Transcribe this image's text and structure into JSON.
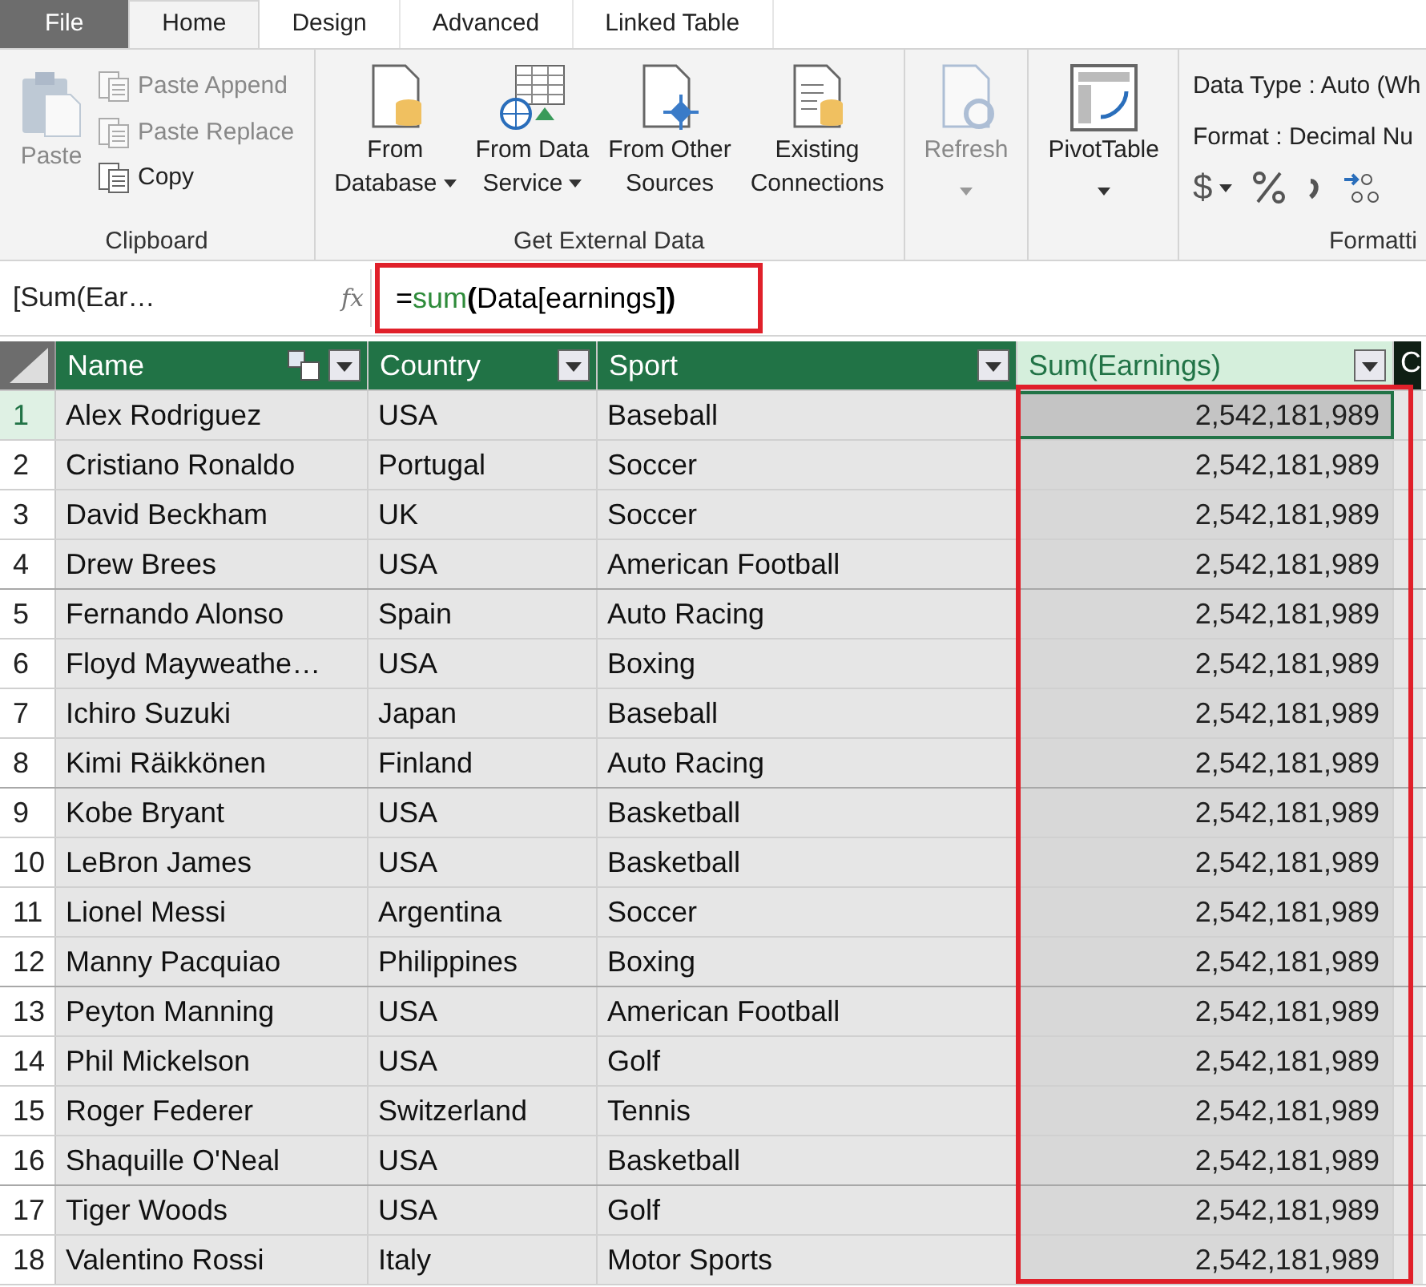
{
  "tabs": [
    {
      "label": "File",
      "kind": "file",
      "selected": false
    },
    {
      "label": "Home",
      "kind": "tab",
      "selected": true
    },
    {
      "label": "Design",
      "kind": "tab",
      "selected": false
    },
    {
      "label": "Advanced",
      "kind": "tab",
      "selected": false
    },
    {
      "label": "Linked Table",
      "kind": "tab",
      "selected": false
    }
  ],
  "ribbon": {
    "groups": [
      {
        "label": "Clipboard",
        "kind": "clipboard",
        "large": {
          "label": "Paste",
          "disabled": true
        },
        "small": [
          {
            "label": "Paste Append",
            "disabled": true
          },
          {
            "label": "Paste Replace",
            "disabled": true
          },
          {
            "label": "Copy",
            "disabled": false
          }
        ]
      },
      {
        "label": "Get External Data",
        "kind": "external",
        "buttons": [
          {
            "lines": [
              "From",
              "Database"
            ],
            "dropdown": true,
            "disabled": false
          },
          {
            "lines": [
              "From Data",
              "Service"
            ],
            "dropdown": true,
            "disabled": false
          },
          {
            "lines": [
              "From Other",
              "Sources"
            ],
            "dropdown": false,
            "disabled": false
          },
          {
            "lines": [
              "Existing",
              "Connections"
            ],
            "dropdown": false,
            "disabled": false
          }
        ]
      },
      {
        "kind": "refresh",
        "buttons": [
          {
            "lines": [
              "Refresh"
            ],
            "dropdown": true,
            "disabled": true
          }
        ]
      },
      {
        "kind": "pivot",
        "buttons": [
          {
            "lines": [
              "PivotTable"
            ],
            "dropdown": true,
            "disabled": false
          }
        ]
      },
      {
        "label": "Formatti",
        "kind": "formatting",
        "fields": [
          "Data Type : Auto (Wh",
          "Format : Decimal Nu"
        ],
        "currency_symbol": "$"
      }
    ]
  },
  "formula_bar": {
    "name_box": "[Sum(Ear…",
    "fx_label": "fx",
    "highlighted": true,
    "formula": [
      {
        "text": "=",
        "kind": "plain"
      },
      {
        "text": "sum",
        "kind": "function"
      },
      {
        "text": "(",
        "kind": "paren"
      },
      {
        "text": "Data[earnings",
        "kind": "plain"
      },
      {
        "text": "])",
        "kind": "paren"
      }
    ]
  },
  "table": {
    "columns": [
      {
        "label": "Name",
        "kind": "column",
        "sort_icon": true
      },
      {
        "label": "Country",
        "kind": "column",
        "sort_icon": false
      },
      {
        "label": "Sport",
        "kind": "column",
        "sort_icon": false
      },
      {
        "label": "Sum(Earnings)",
        "kind": "measure",
        "sort_icon": false
      },
      {
        "label": "C",
        "kind": "cut"
      }
    ],
    "measure_highlighted": true,
    "rows": [
      {
        "number": "1",
        "selected": true,
        "cells": [
          "Alex Rodriguez",
          "USA",
          "Baseball",
          "2,542,181,989"
        ]
      },
      {
        "number": "2",
        "selected": false,
        "cells": [
          "Cristiano Ronaldo",
          "Portugal",
          "Soccer",
          "2,542,181,989"
        ]
      },
      {
        "number": "3",
        "selected": false,
        "cells": [
          "David Beckham",
          "UK",
          "Soccer",
          "2,542,181,989"
        ]
      },
      {
        "number": "4",
        "selected": false,
        "cells": [
          "Drew Brees",
          "USA",
          "American Football",
          "2,542,181,989"
        ]
      },
      {
        "number": "5",
        "selected": false,
        "cells": [
          "Fernando Alonso",
          "Spain",
          "Auto Racing",
          "2,542,181,989"
        ]
      },
      {
        "number": "6",
        "selected": false,
        "cells": [
          "Floyd Mayweathe…",
          "USA",
          "Boxing",
          "2,542,181,989"
        ]
      },
      {
        "number": "7",
        "selected": false,
        "cells": [
          "Ichiro Suzuki",
          "Japan",
          "Baseball",
          "2,542,181,989"
        ]
      },
      {
        "number": "8",
        "selected": false,
        "cells": [
          "Kimi Räikkönen",
          "Finland",
          "Auto Racing",
          "2,542,181,989"
        ]
      },
      {
        "number": "9",
        "selected": false,
        "cells": [
          "Kobe Bryant",
          "USA",
          "Basketball",
          "2,542,181,989"
        ]
      },
      {
        "number": "10",
        "selected": false,
        "cells": [
          "LeBron James",
          "USA",
          "Basketball",
          "2,542,181,989"
        ]
      },
      {
        "number": "11",
        "selected": false,
        "cells": [
          "Lionel Messi",
          "Argentina",
          "Soccer",
          "2,542,181,989"
        ]
      },
      {
        "number": "12",
        "selected": false,
        "cells": [
          "Manny Pacquiao",
          "Philippines",
          "Boxing",
          "2,542,181,989"
        ]
      },
      {
        "number": "13",
        "selected": false,
        "cells": [
          "Peyton Manning",
          "USA",
          "American Football",
          "2,542,181,989"
        ]
      },
      {
        "number": "14",
        "selected": false,
        "cells": [
          "Phil Mickelson",
          "USA",
          "Golf",
          "2,542,181,989"
        ]
      },
      {
        "number": "15",
        "selected": false,
        "cells": [
          "Roger Federer",
          "Switzerland",
          "Tennis",
          "2,542,181,989"
        ]
      },
      {
        "number": "16",
        "selected": false,
        "cells": [
          "Shaquille O'Neal",
          "USA",
          "Basketball",
          "2,542,181,989"
        ]
      },
      {
        "number": "17",
        "selected": false,
        "cells": [
          "Tiger Woods",
          "USA",
          "Golf",
          "2,542,181,989"
        ]
      },
      {
        "number": "18",
        "selected": false,
        "cells": [
          "Valentino Rossi",
          "Italy",
          "Motor Sports",
          "2,542,181,989"
        ]
      }
    ]
  }
}
